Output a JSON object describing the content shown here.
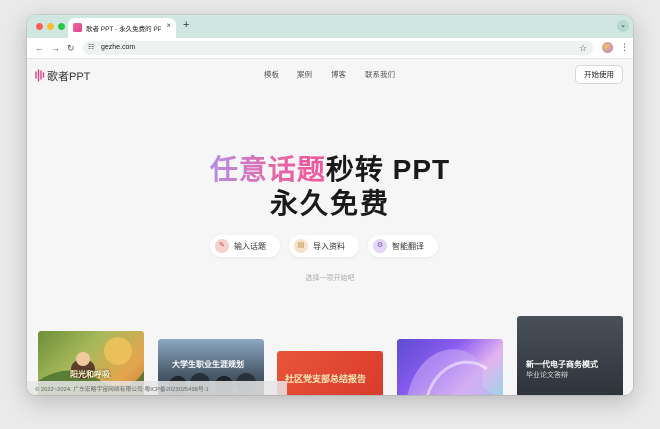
{
  "browser": {
    "tab_title": "歌者 PPT - 永久免费的 PPT 制",
    "url": "gezhe.com",
    "new_tab_symbol": "+",
    "close_symbol": "×"
  },
  "header": {
    "logo_text": "歌者PPT",
    "nav": [
      "模板",
      "案例",
      "博客",
      "联系我们"
    ],
    "start_button": "开始使用"
  },
  "hero": {
    "line1_highlight": "任意话题",
    "line1_rest": "秒转 PPT",
    "line2": "永久免费"
  },
  "actions": [
    {
      "label": "输入话题",
      "icon": "pencil-icon",
      "icon_color": "#f6d2cf"
    },
    {
      "label": "导入资料",
      "icon": "document-icon",
      "icon_color": "#f7e3c9"
    },
    {
      "label": "智能翻译",
      "icon": "translate-icon",
      "icon_color": "#e2d5f5"
    }
  ],
  "hint": "选择一项开始吧",
  "cards": [
    {
      "title": "阳光和呼吸"
    },
    {
      "title": "大学生职业生涯规划"
    },
    {
      "title": "社区党支部总结报告"
    },
    {
      "title": ""
    },
    {
      "title": "新一代电子商务模式",
      "subtitle": "毕业论文答辩"
    }
  ],
  "footer": "© 2022~2024. 广东宏略宇宙网络有限公司 粤ICP备2023025498号-1"
}
